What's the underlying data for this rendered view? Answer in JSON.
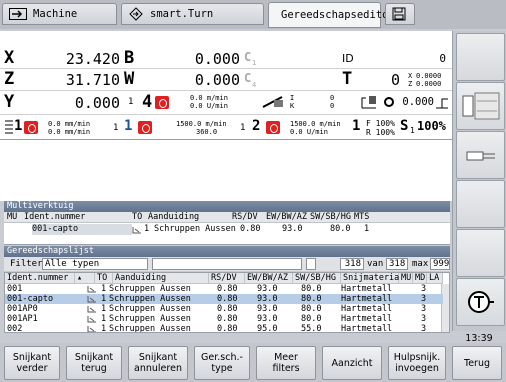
{
  "tabs": [
    {
      "label": "Machine"
    },
    {
      "label": "smart.Turn"
    },
    {
      "label": "Gereedschapseditor"
    }
  ],
  "axes": {
    "x": {
      "label": "X",
      "value": "23.420"
    },
    "z": {
      "label": "Z",
      "value": "31.710"
    },
    "y": {
      "label": "Y",
      "value": "0.000"
    },
    "b": {
      "label": "B",
      "value": "0.000"
    },
    "w": {
      "label": "W",
      "value": "0.000"
    },
    "c1": {
      "label": "C",
      "value": "0.000",
      "sub": "1"
    },
    "c4": {
      "label": "C",
      "value": "0.000",
      "sub": "4"
    }
  },
  "id_label": "ID",
  "id_value": "0",
  "t_label": "T",
  "t_value": "0",
  "offsets": {
    "x_label": "X",
    "x_value": "0.0000",
    "z_label": "Z",
    "z_value": "0.0000"
  },
  "spindle_row": {
    "num1": "1",
    "num4": "4",
    "feed1": "0.0 m/min",
    "feed2": "0.0 U/min",
    "i_label": "I",
    "i_value": "0",
    "k_label": "K",
    "k_value": "0",
    "extra_value": "0.000"
  },
  "status_row": {
    "s1_label": "1",
    "f_a1": "0.0 mm/min",
    "f_a2": "0.0 mm/min",
    "ch1": "1",
    "ch1b": "1",
    "s_a1": "1500.0 m/min",
    "s_a2": "360.0",
    "ch2": "1",
    "ch2b": "2",
    "s_b1": "1500.0 m/min",
    "s_b2": "0.0 U/min",
    "ch3": "1",
    "f_override": "F 100%",
    "r_override": "R 100%",
    "s_label": "S",
    "s_override": "1",
    "s_pct": "100%"
  },
  "multi": {
    "title": "Multiverktuig",
    "headers": [
      "MU",
      "Ident.nummer",
      "TO",
      "Aanduiding",
      "RS/DV",
      "EW/BW/AZ",
      "SW/SB/HG",
      "MTS"
    ],
    "row": {
      "id": "001-capto",
      "to": "1",
      "desc": "Schruppen Aussen",
      "rs": "0.80",
      "ew": "93.0",
      "sw": "80.0",
      "mts": "1"
    }
  },
  "toollist": {
    "title": "Gereedschapslijst",
    "filter_label": "Filter",
    "filter_value": "Alle typen",
    "count": "318",
    "van": "van",
    "total": "318",
    "max": "max",
    "max_value": "999",
    "headers": [
      "Ident.nummer",
      "TO",
      "Aanduiding",
      "RS/DV",
      "EW/BW/AZ",
      "SW/SB/HG",
      "Snijmateriaal",
      "MU",
      "MD",
      "LA"
    ],
    "rows": [
      {
        "id": "001",
        "to": "1",
        "desc": "Schruppen Aussen",
        "rs": "0.80",
        "ew": "93.0",
        "sw": "80.0",
        "mat": "Hartmetall",
        "md": "3"
      },
      {
        "id": "001-capto",
        "to": "1",
        "desc": "Schruppen Aussen",
        "rs": "0.80",
        "ew": "93.0",
        "sw": "80.0",
        "mat": "Hartmetall",
        "md": "3"
      },
      {
        "id": "001AP0",
        "to": "1",
        "desc": "Schruppen Aussen",
        "rs": "0.80",
        "ew": "93.0",
        "sw": "80.0",
        "mat": "Hartmetall",
        "md": "3"
      },
      {
        "id": "001AP1",
        "to": "1",
        "desc": "Schruppen Aussen",
        "rs": "0.80",
        "ew": "93.0",
        "sw": "80.0",
        "mat": "Hartmetall",
        "md": "3"
      },
      {
        "id": "002",
        "to": "1",
        "desc": "Schruppen Aussen",
        "rs": "0.80",
        "ew": "95.0",
        "sw": "55.0",
        "mat": "Hartmetall",
        "md": "3"
      }
    ]
  },
  "clock": "13:39",
  "softkeys": [
    "Snijkant\nverder",
    "Snijkant\nterug",
    "Snijkant\nannuleren",
    "Ger.sch.-\ntype",
    "Meer\nfilters",
    "Aanzicht",
    "Hulpsnijk.\ninvoegen",
    "Terug"
  ],
  "colors": {
    "accent_red": "#e02020",
    "title_bar": "#5f718c",
    "selected_row": "#b7cce7"
  }
}
